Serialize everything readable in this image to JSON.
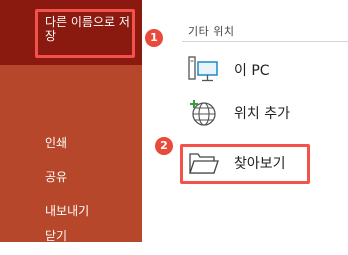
{
  "sidebar": {
    "items": [
      {
        "label": "다른 이름으로 저장"
      },
      {
        "label": "인쇄"
      },
      {
        "label": "공유"
      },
      {
        "label": "내보내기"
      },
      {
        "label": "닫기"
      }
    ]
  },
  "main": {
    "section_title": "기타 위치",
    "locations": [
      {
        "label": "이 PC",
        "icon": "pc-icon"
      },
      {
        "label": "위치 추가",
        "icon": "globe-add-icon"
      },
      {
        "label": "찾아보기",
        "icon": "folder-icon"
      }
    ]
  },
  "annotations": {
    "badge_1": "1",
    "badge_2": "2"
  },
  "colors": {
    "sidebar_bg": "#b7472a",
    "sidebar_selected_bg": "#8a1a10",
    "highlight": "#f2524b",
    "badge": "#e94a3c"
  }
}
